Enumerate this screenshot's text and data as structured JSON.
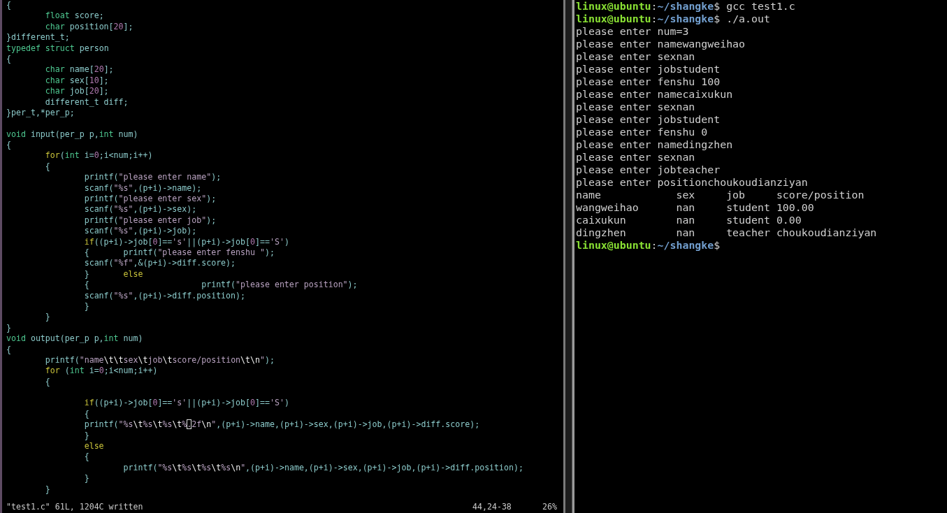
{
  "editor": {
    "lines": [
      {
        "kind": "code",
        "segments": [
          {
            "kind": "plain",
            "text": "{"
          }
        ]
      },
      {
        "kind": "code",
        "segments": [
          {
            "kind": "type",
            "text": "        float"
          },
          {
            "kind": "plain",
            "text": " score;"
          }
        ]
      },
      {
        "kind": "code",
        "segments": [
          {
            "kind": "type",
            "text": "        char"
          },
          {
            "kind": "plain",
            "text": " position["
          },
          {
            "kind": "constant",
            "text": "20"
          },
          {
            "kind": "plain",
            "text": "];"
          }
        ]
      },
      {
        "kind": "code",
        "segments": [
          {
            "kind": "plain",
            "text": "}different_t;"
          }
        ]
      },
      {
        "kind": "code",
        "segments": [
          {
            "kind": "type",
            "text": "typedef"
          },
          {
            "kind": "type",
            "text": " struct"
          },
          {
            "kind": "plain",
            "text": " person"
          }
        ]
      },
      {
        "kind": "code",
        "segments": [
          {
            "kind": "plain",
            "text": "{"
          }
        ]
      },
      {
        "kind": "code",
        "segments": [
          {
            "kind": "type",
            "text": "        char"
          },
          {
            "kind": "plain",
            "text": " name["
          },
          {
            "kind": "constant",
            "text": "20"
          },
          {
            "kind": "plain",
            "text": "];"
          }
        ]
      },
      {
        "kind": "code",
        "segments": [
          {
            "kind": "type",
            "text": "        char"
          },
          {
            "kind": "plain",
            "text": " sex["
          },
          {
            "kind": "constant",
            "text": "10"
          },
          {
            "kind": "plain",
            "text": "];"
          }
        ]
      },
      {
        "kind": "code",
        "segments": [
          {
            "kind": "type",
            "text": "        char"
          },
          {
            "kind": "plain",
            "text": " job["
          },
          {
            "kind": "constant",
            "text": "20"
          },
          {
            "kind": "plain",
            "text": "];"
          }
        ]
      },
      {
        "kind": "code",
        "segments": [
          {
            "kind": "plain",
            "text": "        different_t diff;"
          }
        ]
      },
      {
        "kind": "code",
        "segments": [
          {
            "kind": "plain",
            "text": "}per_t,*per_p;"
          }
        ]
      },
      {
        "kind": "blank"
      },
      {
        "kind": "code",
        "segments": [
          {
            "kind": "type",
            "text": "void"
          },
          {
            "kind": "plain",
            "text": " input(per_p p,"
          },
          {
            "kind": "type",
            "text": "int"
          },
          {
            "kind": "plain",
            "text": " num)"
          }
        ]
      },
      {
        "kind": "code",
        "segments": [
          {
            "kind": "plain",
            "text": "{"
          }
        ]
      },
      {
        "kind": "code",
        "segments": [
          {
            "kind": "statement",
            "text": "        for"
          },
          {
            "kind": "plain",
            "text": "("
          },
          {
            "kind": "type",
            "text": "int"
          },
          {
            "kind": "plain",
            "text": " i="
          },
          {
            "kind": "constant",
            "text": "0"
          },
          {
            "kind": "plain",
            "text": ";i<num;i++)"
          }
        ]
      },
      {
        "kind": "code",
        "segments": [
          {
            "kind": "plain",
            "text": "        {"
          }
        ]
      },
      {
        "kind": "code",
        "segments": [
          {
            "kind": "plain",
            "text": "                printf("
          },
          {
            "kind": "string",
            "text": "\"please enter name\""
          },
          {
            "kind": "plain",
            "text": ");"
          }
        ]
      },
      {
        "kind": "code",
        "segments": [
          {
            "kind": "plain",
            "text": "                scanf("
          },
          {
            "kind": "string",
            "text": "\"%s\""
          },
          {
            "kind": "plain",
            "text": ",(p+i)->name);"
          }
        ]
      },
      {
        "kind": "code",
        "segments": [
          {
            "kind": "plain",
            "text": "                printf("
          },
          {
            "kind": "string",
            "text": "\"please enter sex\""
          },
          {
            "kind": "plain",
            "text": ");"
          }
        ]
      },
      {
        "kind": "code",
        "segments": [
          {
            "kind": "plain",
            "text": "                scanf("
          },
          {
            "kind": "string",
            "text": "\"%s\""
          },
          {
            "kind": "plain",
            "text": ",(p+i)->sex);"
          }
        ]
      },
      {
        "kind": "code",
        "segments": [
          {
            "kind": "plain",
            "text": "                printf("
          },
          {
            "kind": "string",
            "text": "\"please enter job\""
          },
          {
            "kind": "plain",
            "text": ");"
          }
        ]
      },
      {
        "kind": "code",
        "segments": [
          {
            "kind": "plain",
            "text": "                scanf("
          },
          {
            "kind": "string",
            "text": "\"%s\""
          },
          {
            "kind": "plain",
            "text": ",(p+i)->job);"
          }
        ]
      },
      {
        "kind": "code",
        "segments": [
          {
            "kind": "statement",
            "text": "                if"
          },
          {
            "kind": "plain",
            "text": "((p+i)->job["
          },
          {
            "kind": "constant",
            "text": "0"
          },
          {
            "kind": "plain",
            "text": "]=="
          },
          {
            "kind": "string",
            "text": "'s'"
          },
          {
            "kind": "plain",
            "text": "||(p+i)->job["
          },
          {
            "kind": "constant",
            "text": "0"
          },
          {
            "kind": "plain",
            "text": "]=="
          },
          {
            "kind": "string",
            "text": "'S'"
          },
          {
            "kind": "plain",
            "text": ")"
          }
        ]
      },
      {
        "kind": "code",
        "segments": [
          {
            "kind": "plain",
            "text": "                {       printf("
          },
          {
            "kind": "string",
            "text": "\"please enter fenshu \""
          },
          {
            "kind": "plain",
            "text": ");"
          }
        ]
      },
      {
        "kind": "code",
        "segments": [
          {
            "kind": "plain",
            "text": "                scanf("
          },
          {
            "kind": "string",
            "text": "\"%f\""
          },
          {
            "kind": "plain",
            "text": ",&(p+i)->diff.score);"
          }
        ]
      },
      {
        "kind": "code",
        "segments": [
          {
            "kind": "plain",
            "text": "                }       "
          },
          {
            "kind": "statement",
            "text": "else"
          }
        ]
      },
      {
        "kind": "code",
        "segments": [
          {
            "kind": "plain",
            "text": "                {                       printf("
          },
          {
            "kind": "string",
            "text": "\"please enter position\""
          },
          {
            "kind": "plain",
            "text": ");"
          }
        ]
      },
      {
        "kind": "code",
        "segments": [
          {
            "kind": "plain",
            "text": "                scanf("
          },
          {
            "kind": "string",
            "text": "\"%s\""
          },
          {
            "kind": "plain",
            "text": ",(p+i)->diff.position);"
          }
        ]
      },
      {
        "kind": "code",
        "segments": [
          {
            "kind": "plain",
            "text": "                }"
          }
        ]
      },
      {
        "kind": "code",
        "segments": [
          {
            "kind": "plain",
            "text": "        }"
          }
        ]
      },
      {
        "kind": "code",
        "segments": [
          {
            "kind": "plain",
            "text": "}"
          }
        ]
      },
      {
        "kind": "code",
        "segments": [
          {
            "kind": "type",
            "text": "void"
          },
          {
            "kind": "plain",
            "text": " output(per_p p,"
          },
          {
            "kind": "type",
            "text": "int"
          },
          {
            "kind": "plain",
            "text": " num)"
          }
        ]
      },
      {
        "kind": "code",
        "segments": [
          {
            "kind": "plain",
            "text": "{"
          }
        ]
      },
      {
        "kind": "code",
        "segments": [
          {
            "kind": "plain",
            "text": "        printf("
          },
          {
            "kind": "string",
            "text": "\"name"
          },
          {
            "kind": "escape",
            "text": "\\t\\t"
          },
          {
            "kind": "string",
            "text": "sex"
          },
          {
            "kind": "escape",
            "text": "\\t"
          },
          {
            "kind": "string",
            "text": "job"
          },
          {
            "kind": "escape",
            "text": "\\t"
          },
          {
            "kind": "string",
            "text": "score/position"
          },
          {
            "kind": "escape",
            "text": "\\t\\n"
          },
          {
            "kind": "string",
            "text": "\""
          },
          {
            "kind": "plain",
            "text": ");"
          }
        ]
      },
      {
        "kind": "code",
        "segments": [
          {
            "kind": "statement",
            "text": "        for"
          },
          {
            "kind": "plain",
            "text": " ("
          },
          {
            "kind": "type",
            "text": "int"
          },
          {
            "kind": "plain",
            "text": " i="
          },
          {
            "kind": "constant",
            "text": "0"
          },
          {
            "kind": "plain",
            "text": ";i<num;i++)"
          }
        ]
      },
      {
        "kind": "code",
        "segments": [
          {
            "kind": "plain",
            "text": "        {"
          }
        ]
      },
      {
        "kind": "blank"
      },
      {
        "kind": "code",
        "segments": [
          {
            "kind": "statement",
            "text": "                if"
          },
          {
            "kind": "plain",
            "text": "((p+i)->job["
          },
          {
            "kind": "constant",
            "text": "0"
          },
          {
            "kind": "plain",
            "text": "]=="
          },
          {
            "kind": "string",
            "text": "'s'"
          },
          {
            "kind": "plain",
            "text": "||(p+i)->job["
          },
          {
            "kind": "constant",
            "text": "0"
          },
          {
            "kind": "plain",
            "text": "]=="
          },
          {
            "kind": "string",
            "text": "'S'"
          },
          {
            "kind": "plain",
            "text": ")"
          }
        ]
      },
      {
        "kind": "code",
        "segments": [
          {
            "kind": "plain",
            "text": "                {"
          }
        ]
      },
      {
        "kind": "code",
        "segments": [
          {
            "kind": "plain",
            "text": "                printf("
          },
          {
            "kind": "string",
            "text": "\"%s"
          },
          {
            "kind": "escape",
            "text": "\\t"
          },
          {
            "kind": "string",
            "text": "%s"
          },
          {
            "kind": "escape",
            "text": "\\t"
          },
          {
            "kind": "string",
            "text": "%s"
          },
          {
            "kind": "escape",
            "text": "\\t"
          },
          {
            "kind": "string",
            "text": "%"
          },
          {
            "kind": "cursor",
            "text": "."
          },
          {
            "kind": "string",
            "text": "2f"
          },
          {
            "kind": "escape",
            "text": "\\n"
          },
          {
            "kind": "string",
            "text": "\""
          },
          {
            "kind": "plain",
            "text": ",(p+i)->name,(p+i)->sex,(p+i)->job,(p+i)->diff.score);"
          }
        ]
      },
      {
        "kind": "code",
        "segments": [
          {
            "kind": "plain",
            "text": "                }"
          }
        ]
      },
      {
        "kind": "code",
        "segments": [
          {
            "kind": "statement",
            "text": "                else"
          }
        ]
      },
      {
        "kind": "code",
        "segments": [
          {
            "kind": "plain",
            "text": "                {"
          }
        ]
      },
      {
        "kind": "code",
        "segments": [
          {
            "kind": "plain",
            "text": "                        printf("
          },
          {
            "kind": "string",
            "text": "\"%s"
          },
          {
            "kind": "escape",
            "text": "\\t"
          },
          {
            "kind": "string",
            "text": "%s"
          },
          {
            "kind": "escape",
            "text": "\\t"
          },
          {
            "kind": "string",
            "text": "%s"
          },
          {
            "kind": "escape",
            "text": "\\t"
          },
          {
            "kind": "string",
            "text": "%s"
          },
          {
            "kind": "escape",
            "text": "\\n"
          },
          {
            "kind": "string",
            "text": "\""
          },
          {
            "kind": "plain",
            "text": ",(p+i)->name,(p+i)->sex,(p+i)->job,(p+i)->diff.position);"
          }
        ]
      },
      {
        "kind": "code",
        "segments": [
          {
            "kind": "plain",
            "text": "                }"
          }
        ]
      },
      {
        "kind": "code",
        "segments": [
          {
            "kind": "plain",
            "text": "        }"
          }
        ]
      }
    ],
    "status": {
      "message": "\"test1.c\" 61L, 1204C written",
      "position": "44,24-38",
      "scroll": "26%"
    }
  },
  "terminal": {
    "lines": [
      {
        "segments": [
          {
            "kind": "user",
            "text": "linux@ubuntu"
          },
          {
            "kind": "plain",
            "text": ":"
          },
          {
            "kind": "path",
            "text": "~/shangke"
          },
          {
            "kind": "plain",
            "text": "$ gcc test1.c"
          }
        ]
      },
      {
        "segments": [
          {
            "kind": "user",
            "text": "linux@ubuntu"
          },
          {
            "kind": "plain",
            "text": ":"
          },
          {
            "kind": "path",
            "text": "~/shangke"
          },
          {
            "kind": "plain",
            "text": "$ ./a.out"
          }
        ]
      },
      {
        "segments": [
          {
            "kind": "plain",
            "text": "please enter num=3"
          }
        ]
      },
      {
        "segments": [
          {
            "kind": "plain",
            "text": "please enter namewangweihao"
          }
        ]
      },
      {
        "segments": [
          {
            "kind": "plain",
            "text": "please enter sexnan"
          }
        ]
      },
      {
        "segments": [
          {
            "kind": "plain",
            "text": "please enter jobstudent"
          }
        ]
      },
      {
        "segments": [
          {
            "kind": "plain",
            "text": "please enter fenshu 100"
          }
        ]
      },
      {
        "segments": [
          {
            "kind": "plain",
            "text": "please enter namecaixukun"
          }
        ]
      },
      {
        "segments": [
          {
            "kind": "plain",
            "text": "please enter sexnan"
          }
        ]
      },
      {
        "segments": [
          {
            "kind": "plain",
            "text": "please enter jobstudent"
          }
        ]
      },
      {
        "segments": [
          {
            "kind": "plain",
            "text": "please enter fenshu 0"
          }
        ]
      },
      {
        "segments": [
          {
            "kind": "plain",
            "text": "please enter namedingzhen"
          }
        ]
      },
      {
        "segments": [
          {
            "kind": "plain",
            "text": "please enter sexnan"
          }
        ]
      },
      {
        "segments": [
          {
            "kind": "plain",
            "text": "please enter jobteacher"
          }
        ]
      },
      {
        "segments": [
          {
            "kind": "plain",
            "text": "please enter positionchoukoudianziyan"
          }
        ]
      },
      {
        "segments": [
          {
            "kind": "plain",
            "text": "name            sex     job     score/position"
          }
        ]
      },
      {
        "segments": [
          {
            "kind": "plain",
            "text": "wangweihao      nan     student 100.00"
          }
        ]
      },
      {
        "segments": [
          {
            "kind": "plain",
            "text": "caixukun        nan     student 0.00"
          }
        ]
      },
      {
        "segments": [
          {
            "kind": "plain",
            "text": "dingzhen        nan     teacher choukoudianziyan"
          }
        ]
      },
      {
        "segments": [
          {
            "kind": "user",
            "text": "linux@ubuntu"
          },
          {
            "kind": "plain",
            "text": ":"
          },
          {
            "kind": "path",
            "text": "~/shangke"
          },
          {
            "kind": "plain",
            "text": "$"
          }
        ]
      }
    ]
  }
}
